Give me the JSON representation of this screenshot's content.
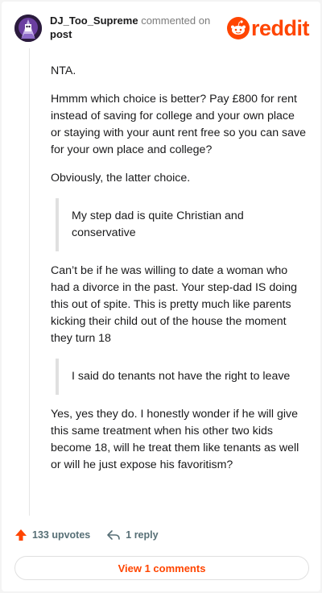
{
  "header": {
    "username": "DJ_Too_Supreme",
    "action_text": "commented on",
    "post_link": "post",
    "logo_text": "reddit"
  },
  "comment": {
    "paragraph_1": "NTA.",
    "paragraph_2": "Hmmm which choice is better? Pay £800 for rent instead of saving for college and your own place or staying with your aunt rent free so you can save for your own place and college?",
    "paragraph_3": "Obviously, the latter choice.",
    "quote_1": "My step dad is quite Christian and conservative",
    "paragraph_4": "Can’t be if he was willing to date a woman who had a divorce in the past. Your step-dad IS doing this out of spite. This is pretty much like parents kicking their child out of the house the moment they turn 18",
    "quote_2": "I said do tenants not have the right to leave",
    "paragraph_5": "Yes, yes they do. I honestly wonder if he will give this same treatment when his other two kids become 18, will he treat them like tenants as well or will he just expose his favoritism?"
  },
  "footer": {
    "upvotes": "133 upvotes",
    "replies": "1 reply",
    "view_comments": "View 1 comments"
  },
  "colors": {
    "brand": "#ff4500",
    "muted": "#576f76"
  },
  "icons": {
    "upvote": "upvote-arrow-icon",
    "reply": "reply-arrow-icon",
    "logo": "reddit-snoo-icon"
  }
}
